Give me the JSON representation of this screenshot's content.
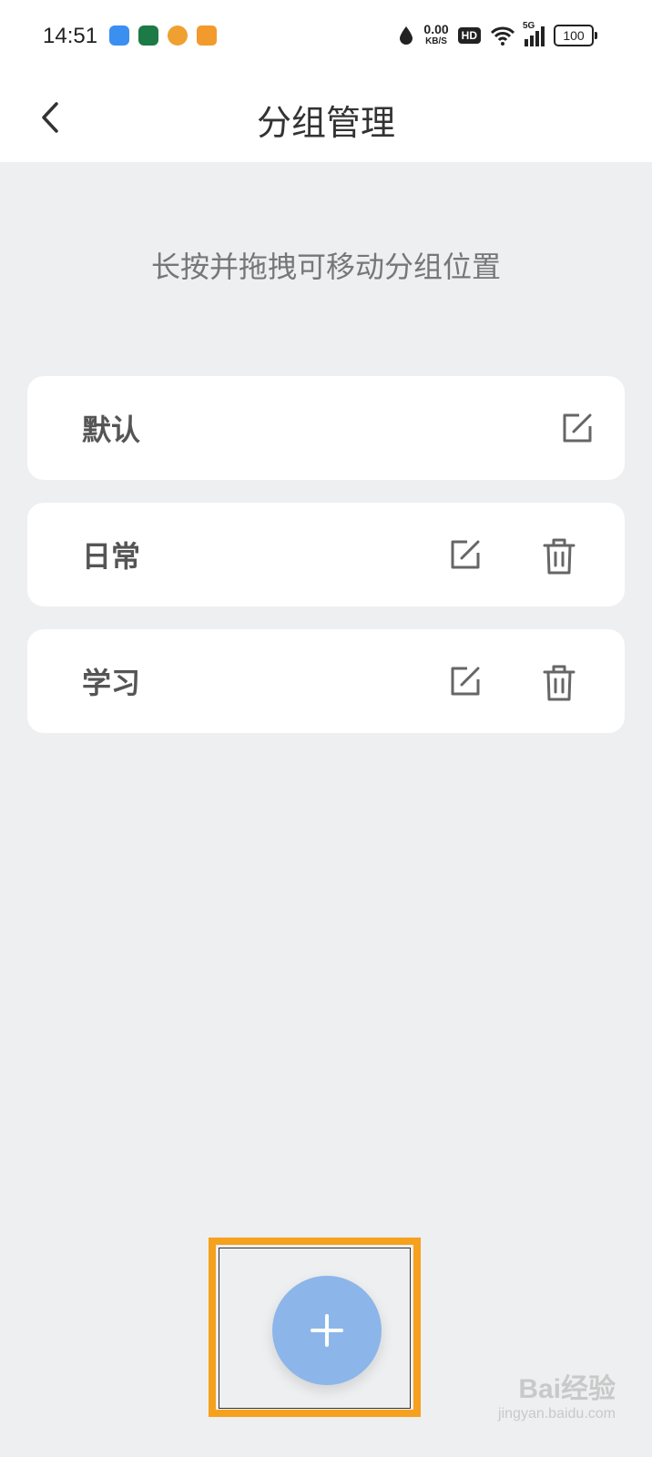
{
  "status_bar": {
    "time": "14:51",
    "speed_value": "0.00",
    "speed_unit": "KB/S",
    "hd_label": "HD",
    "network_label": "5G",
    "battery_level": "100"
  },
  "header": {
    "title": "分组管理",
    "back_icon": "chevron-left-icon"
  },
  "hint_text": "长按并拖拽可移动分组位置",
  "groups": [
    {
      "name": "默认",
      "editable": true,
      "deletable": false
    },
    {
      "name": "日常",
      "editable": true,
      "deletable": true
    },
    {
      "name": "学习",
      "editable": true,
      "deletable": true
    }
  ],
  "fab": {
    "icon": "plus-icon",
    "color": "#8cb6ea"
  },
  "highlight_color": "#f6a11e",
  "watermark": {
    "brand": "Bai经验",
    "site": "jingyan.baidu.com"
  }
}
